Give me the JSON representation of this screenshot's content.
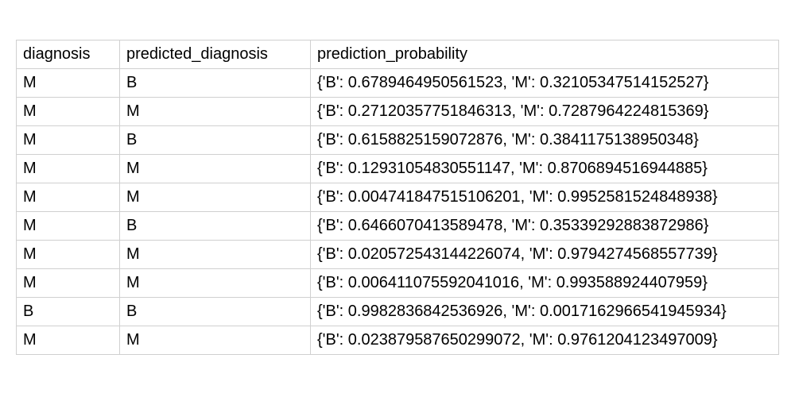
{
  "table": {
    "headers": {
      "diagnosis": "diagnosis",
      "predicted_diagnosis": "predicted_diagnosis",
      "prediction_probability": "prediction_probability"
    },
    "rows": [
      {
        "diagnosis": "M",
        "predicted_diagnosis": "B",
        "prediction_probability": "{'B': 0.6789464950561523, 'M': 0.32105347514152527}"
      },
      {
        "diagnosis": "M",
        "predicted_diagnosis": "M",
        "prediction_probability": "{'B': 0.27120357751846313, 'M': 0.7287964224815369}"
      },
      {
        "diagnosis": "M",
        "predicted_diagnosis": "B",
        "prediction_probability": "{'B': 0.6158825159072876, 'M': 0.3841175138950348}"
      },
      {
        "diagnosis": "M",
        "predicted_diagnosis": "M",
        "prediction_probability": "{'B': 0.12931054830551147, 'M': 0.8706894516944885}"
      },
      {
        "diagnosis": "M",
        "predicted_diagnosis": "M",
        "prediction_probability": "{'B': 0.004741847515106201, 'M': 0.9952581524848938}"
      },
      {
        "diagnosis": "M",
        "predicted_diagnosis": "B",
        "prediction_probability": "{'B': 0.6466070413589478, 'M': 0.35339292883872986}"
      },
      {
        "diagnosis": "M",
        "predicted_diagnosis": "M",
        "prediction_probability": "{'B': 0.020572543144226074, 'M': 0.9794274568557739}"
      },
      {
        "diagnosis": "M",
        "predicted_diagnosis": "M",
        "prediction_probability": "{'B': 0.006411075592041016, 'M': 0.993588924407959}"
      },
      {
        "diagnosis": "B",
        "predicted_diagnosis": "B",
        "prediction_probability": "{'B': 0.9982836842536926, 'M': 0.0017162966541945934}"
      },
      {
        "diagnosis": "M",
        "predicted_diagnosis": "M",
        "prediction_probability": "{'B': 0.023879587650299072, 'M': 0.9761204123497009}"
      }
    ]
  }
}
